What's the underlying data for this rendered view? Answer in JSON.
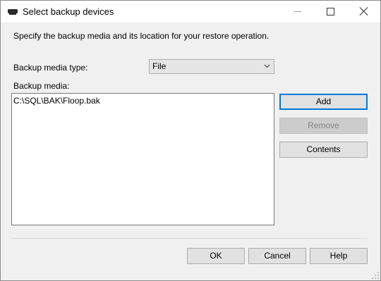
{
  "window": {
    "title": "Select backup devices",
    "title_icon": "backup-device-icon"
  },
  "controls": {
    "minimize_icon": "minimize-icon",
    "maximize_icon": "maximize-icon",
    "close_icon": "close-icon"
  },
  "dialog": {
    "description": "Specify the backup media and its location for your restore operation.",
    "media_type_label": "Backup media type:",
    "media_type_value": "File",
    "media_label": "Backup media:",
    "media_items": [
      "C:\\SQL\\BAK\\Floop.bak"
    ]
  },
  "side_buttons": {
    "add": "Add",
    "remove": "Remove",
    "contents": "Contents"
  },
  "footer": {
    "ok": "OK",
    "cancel": "Cancel",
    "help": "Help"
  },
  "colors": {
    "accent": "#0078d7",
    "background": "#f0f0f0"
  }
}
